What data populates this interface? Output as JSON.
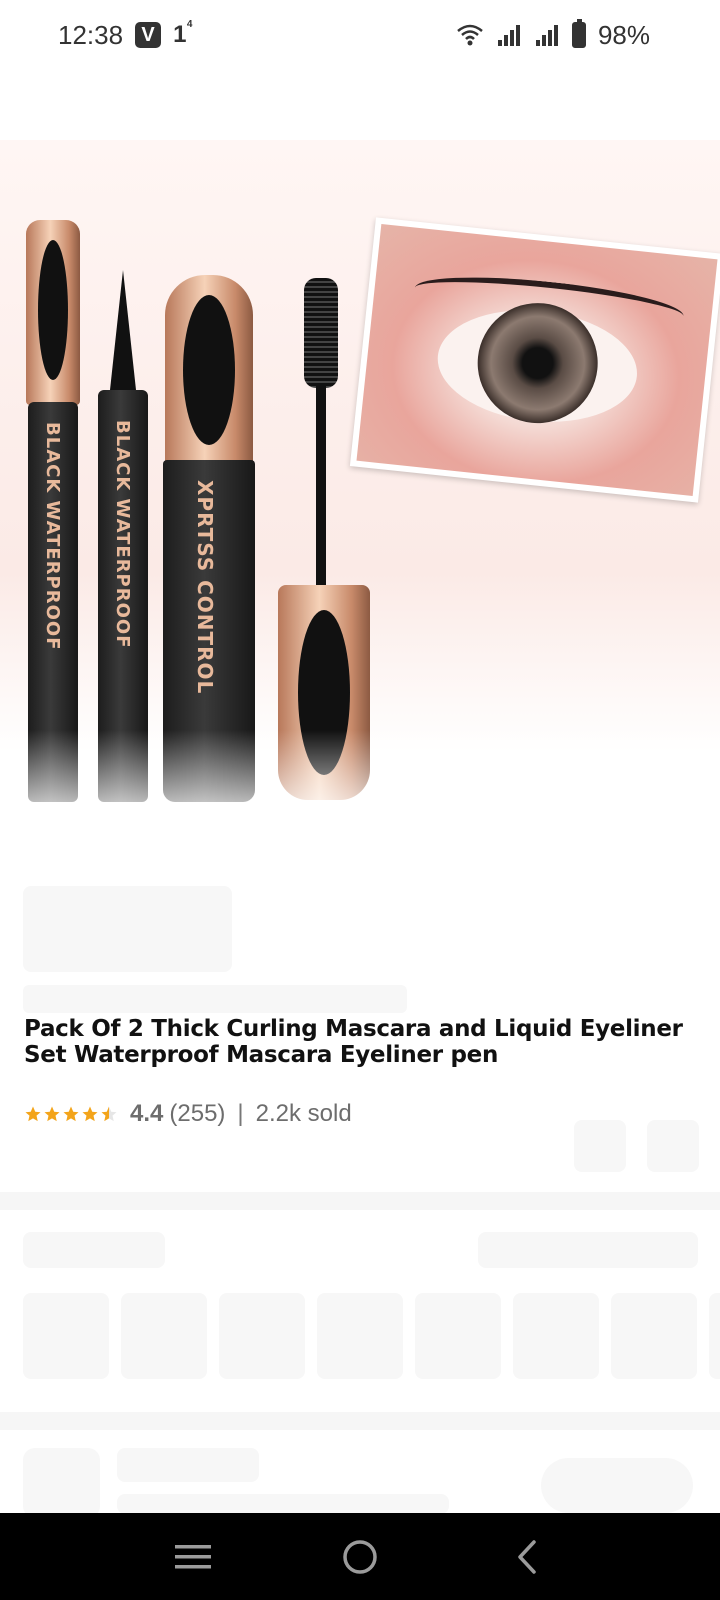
{
  "status_bar": {
    "time": "12:38",
    "notif_v": "V",
    "notif_one": "1",
    "notif_one_sup": "4",
    "battery": "98%",
    "icons": [
      "wifi-icon",
      "signal-icon",
      "signal-icon",
      "battery-icon"
    ]
  },
  "product": {
    "image_alt": "Mascara and eyeliner set with eye close-up",
    "tube_labels": [
      "BLACK WATERPROOF",
      "BLACK WATERPROOF",
      "XPRTSS CONTROL"
    ],
    "title": "Pack Of 2 Thick Curling Mascara and Liquid Eyeliner Set Waterproof Mascara Eyeliner pen",
    "rating": "4.4",
    "stars": "4.5 of 5",
    "reviews": "(255)",
    "separator": "|",
    "sold": "2.2k sold"
  },
  "nav": {
    "icons": [
      "menu-icon",
      "home-icon",
      "back-icon"
    ]
  }
}
